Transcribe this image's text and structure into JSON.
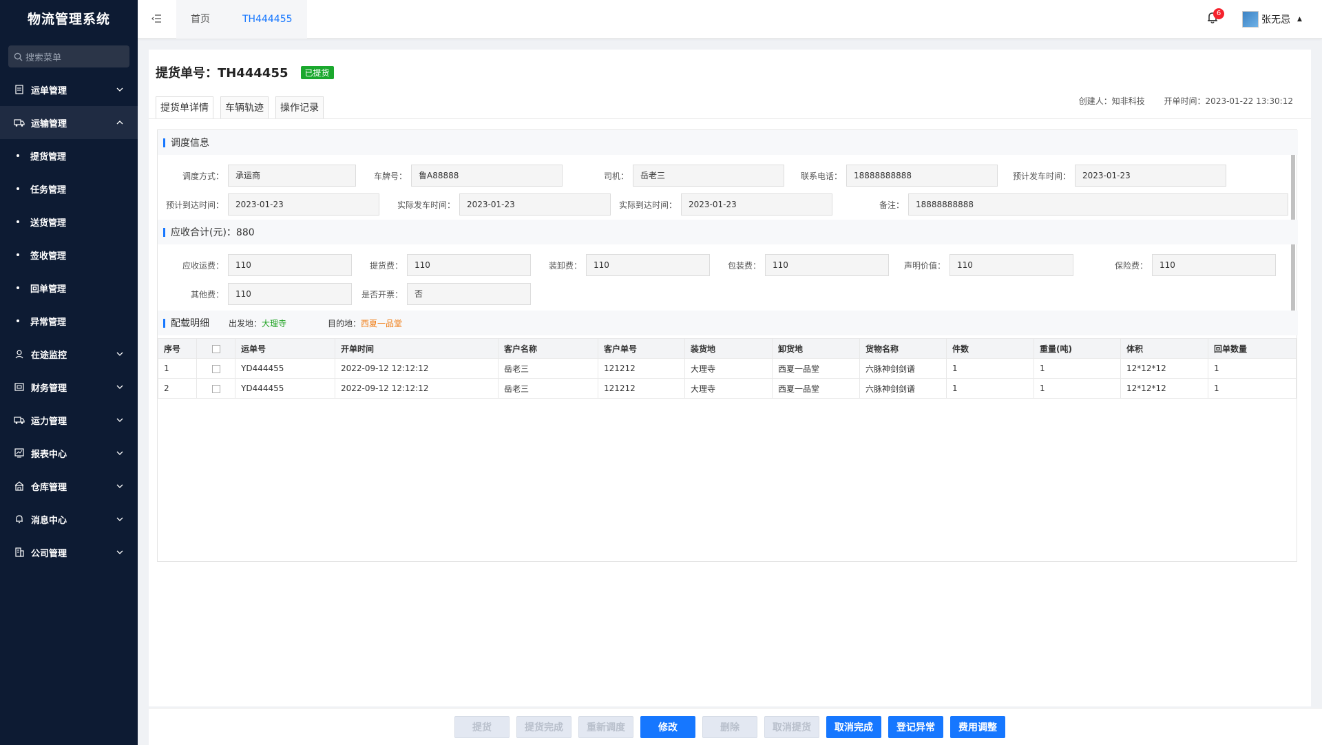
{
  "app": {
    "title": "物流管理系统"
  },
  "sidebar": {
    "search_placeholder": "搜索菜单",
    "items": [
      {
        "label": "运单管理",
        "icon": "document-icon"
      },
      {
        "label": "运输管理",
        "icon": "truck-icon",
        "open": true
      },
      {
        "label": "在途监控",
        "icon": "location-icon"
      },
      {
        "label": "财务管理",
        "icon": "wallet-icon"
      },
      {
        "label": "运力管理",
        "icon": "truck-icon"
      },
      {
        "label": "报表中心",
        "icon": "chart-icon"
      },
      {
        "label": "仓库管理",
        "icon": "warehouse-icon"
      },
      {
        "label": "消息中心",
        "icon": "bell-icon"
      },
      {
        "label": "公司管理",
        "icon": "building-icon"
      }
    ],
    "subitems": [
      "提货管理",
      "任务管理",
      "送货管理",
      "签收管理",
      "回单管理",
      "异常管理"
    ]
  },
  "header": {
    "tab_home": "首页",
    "tab_active": "TH444455",
    "notifications": "6",
    "user_name": "张无忌"
  },
  "page": {
    "title": "提货单号：TH444455",
    "status": "已提货",
    "tabs": [
      "提货单详情",
      "车辆轨迹",
      "操作记录"
    ],
    "creator_label": "创建人：知非科技",
    "open_time_label": "开单时间：2023-01-22  13:30:12"
  },
  "dispatch": {
    "heading": "调度信息",
    "fields": [
      {
        "label": "调度方式：",
        "value": "承运商"
      },
      {
        "label": "车牌号：",
        "value": "鲁A88888"
      },
      {
        "label": "司机：",
        "value": "岳老三"
      },
      {
        "label": "联系电话：",
        "value": "18888888888"
      },
      {
        "label": "预计发车时间：",
        "value": "2023-01-23"
      },
      {
        "label": "预计到达时间：",
        "value": "2023-01-23"
      },
      {
        "label": "实际发车时间：",
        "value": "2023-01-23"
      },
      {
        "label": "实际到达时间：",
        "value": "2023-01-23"
      },
      {
        "label": "备注：",
        "value": "18888888888"
      }
    ]
  },
  "fees": {
    "heading": "应收合计(元)：880",
    "fields": [
      {
        "label": "应收运费：",
        "value": "110"
      },
      {
        "label": "提货费：",
        "value": "110"
      },
      {
        "label": "装卸费：",
        "value": "110"
      },
      {
        "label": "包装费：",
        "value": "110"
      },
      {
        "label": "声明价值：",
        "value": "110"
      },
      {
        "label": "保险费：",
        "value": "110"
      },
      {
        "label": "其他费：",
        "value": "110"
      },
      {
        "label": "是否开票：",
        "value": "否"
      }
    ]
  },
  "loading": {
    "heading": "配载明细",
    "origin_label": "出发地：",
    "origin": "大理寺",
    "dest_label": "目的地：",
    "dest": "西夏一品堂",
    "columns": [
      "序号",
      "",
      "运单号",
      "开单时间",
      "客户名称",
      "客户单号",
      "装货地",
      "卸货地",
      "货物名称",
      "件数",
      "重量(吨)",
      "体积",
      "回单数量"
    ],
    "rows": [
      [
        "1",
        "",
        "YD444455",
        "2022-09-12 12:12:12",
        "岳老三",
        "121212",
        "大理寺",
        "西夏一品堂",
        "六脉神剑剑谱",
        "1",
        "1",
        "12*12*12",
        "1"
      ],
      [
        "2",
        "",
        "YD444455",
        "2022-09-12 12:12:12",
        "岳老三",
        "121212",
        "大理寺",
        "西夏一品堂",
        "六脉神剑剑谱",
        "1",
        "1",
        "12*12*12",
        "1"
      ]
    ]
  },
  "footer": {
    "buttons": [
      {
        "label": "提货",
        "enabled": false
      },
      {
        "label": "提货完成",
        "enabled": false
      },
      {
        "label": "重新调度",
        "enabled": false
      },
      {
        "label": "修改",
        "enabled": true
      },
      {
        "label": "删除",
        "enabled": false
      },
      {
        "label": "取消提货",
        "enabled": false
      },
      {
        "label": "取消完成",
        "enabled": true
      },
      {
        "label": "登记异常",
        "enabled": true
      },
      {
        "label": "费用调整",
        "enabled": true
      }
    ]
  },
  "colors": {
    "primary": "#1677ff",
    "sidebar": "#0d1b33",
    "success": "#1aa82d",
    "warning": "#f07b12"
  }
}
